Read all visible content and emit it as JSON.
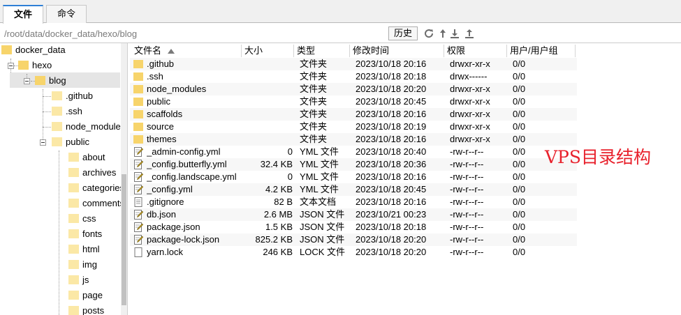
{
  "tabs": [
    {
      "label": "文件",
      "active": true
    },
    {
      "label": "命令",
      "active": false
    }
  ],
  "path": {
    "value": "/root/data/docker_data/hexo/blog",
    "history_label": "历史"
  },
  "toolbar_icons": [
    "refresh-icon",
    "up-icon",
    "download-icon",
    "upload-icon"
  ],
  "tree": {
    "items": [
      {
        "label": "docker_data",
        "level": 0
      },
      {
        "label": "hexo",
        "level": 1
      },
      {
        "label": "blog",
        "level": 2,
        "selected": true
      },
      {
        "label": ".github",
        "level": 3
      },
      {
        "label": ".ssh",
        "level": 3
      },
      {
        "label": "node_modules",
        "level": 3
      },
      {
        "label": "public",
        "level": 3
      },
      {
        "label": "about",
        "level": 4
      },
      {
        "label": "archives",
        "level": 4
      },
      {
        "label": "categories",
        "level": 4
      },
      {
        "label": "comments",
        "level": 4
      },
      {
        "label": "css",
        "level": 4
      },
      {
        "label": "fonts",
        "level": 4
      },
      {
        "label": "html",
        "level": 4
      },
      {
        "label": "img",
        "level": 4
      },
      {
        "label": "js",
        "level": 4
      },
      {
        "label": "page",
        "level": 4
      },
      {
        "label": "posts",
        "level": 4
      }
    ]
  },
  "columns": {
    "name": "文件名",
    "size": "大小",
    "type": "类型",
    "modified": "修改时间",
    "perm": "权限",
    "owner": "用户/用户组"
  },
  "files": [
    {
      "name": ".github",
      "size": "",
      "type": "文件夹",
      "modified": "2023/10/18 20:16",
      "perm": "drwxr-xr-x",
      "owner": "0/0",
      "kind": "folder"
    },
    {
      "name": ".ssh",
      "size": "",
      "type": "文件夹",
      "modified": "2023/10/18 20:18",
      "perm": "drwx------",
      "owner": "0/0",
      "kind": "folder"
    },
    {
      "name": "node_modules",
      "size": "",
      "type": "文件夹",
      "modified": "2023/10/18 20:20",
      "perm": "drwxr-xr-x",
      "owner": "0/0",
      "kind": "folder"
    },
    {
      "name": "public",
      "size": "",
      "type": "文件夹",
      "modified": "2023/10/18 20:45",
      "perm": "drwxr-xr-x",
      "owner": "0/0",
      "kind": "folder"
    },
    {
      "name": "scaffolds",
      "size": "",
      "type": "文件夹",
      "modified": "2023/10/18 20:16",
      "perm": "drwxr-xr-x",
      "owner": "0/0",
      "kind": "folder"
    },
    {
      "name": "source",
      "size": "",
      "type": "文件夹",
      "modified": "2023/10/18 20:19",
      "perm": "drwxr-xr-x",
      "owner": "0/0",
      "kind": "folder"
    },
    {
      "name": "themes",
      "size": "",
      "type": "文件夹",
      "modified": "2023/10/18 20:16",
      "perm": "drwxr-xr-x",
      "owner": "0/0",
      "kind": "folder"
    },
    {
      "name": "_admin-config.yml",
      "size": "0",
      "type": "YML 文件",
      "modified": "2023/10/18 20:40",
      "perm": "-rw-r--r--",
      "owner": "0/0",
      "kind": "edit"
    },
    {
      "name": "_config.butterfly.yml",
      "size": "32.4 KB",
      "type": "YML 文件",
      "modified": "2023/10/18 20:36",
      "perm": "-rw-r--r--",
      "owner": "0/0",
      "kind": "edit"
    },
    {
      "name": "_config.landscape.yml",
      "size": "0",
      "type": "YML 文件",
      "modified": "2023/10/18 20:16",
      "perm": "-rw-r--r--",
      "owner": "0/0",
      "kind": "edit"
    },
    {
      "name": "_config.yml",
      "size": "4.2 KB",
      "type": "YML 文件",
      "modified": "2023/10/18 20:45",
      "perm": "-rw-r--r--",
      "owner": "0/0",
      "kind": "edit"
    },
    {
      "name": ".gitignore",
      "size": "82 B",
      "type": "文本文档",
      "modified": "2023/10/18 20:16",
      "perm": "-rw-r--r--",
      "owner": "0/0",
      "kind": "text"
    },
    {
      "name": "db.json",
      "size": "2.6 MB",
      "type": "JSON 文件",
      "modified": "2023/10/21 00:23",
      "perm": "-rw-r--r--",
      "owner": "0/0",
      "kind": "edit"
    },
    {
      "name": "package.json",
      "size": "1.5 KB",
      "type": "JSON 文件",
      "modified": "2023/10/18 20:18",
      "perm": "-rw-r--r--",
      "owner": "0/0",
      "kind": "edit"
    },
    {
      "name": "package-lock.json",
      "size": "825.2 KB",
      "type": "JSON 文件",
      "modified": "2023/10/18 20:20",
      "perm": "-rw-r--r--",
      "owner": "0/0",
      "kind": "edit"
    },
    {
      "name": "yarn.lock",
      "size": "246 KB",
      "type": "LOCK 文件",
      "modified": "2023/10/18 20:20",
      "perm": "-rw-r--r--",
      "owner": "0/0",
      "kind": "blank"
    }
  ],
  "annotation": "VPS目录结构",
  "colors": {
    "folder": "#f7d46b",
    "accent": "#2f7fd6",
    "annotation": "#e8212c"
  }
}
